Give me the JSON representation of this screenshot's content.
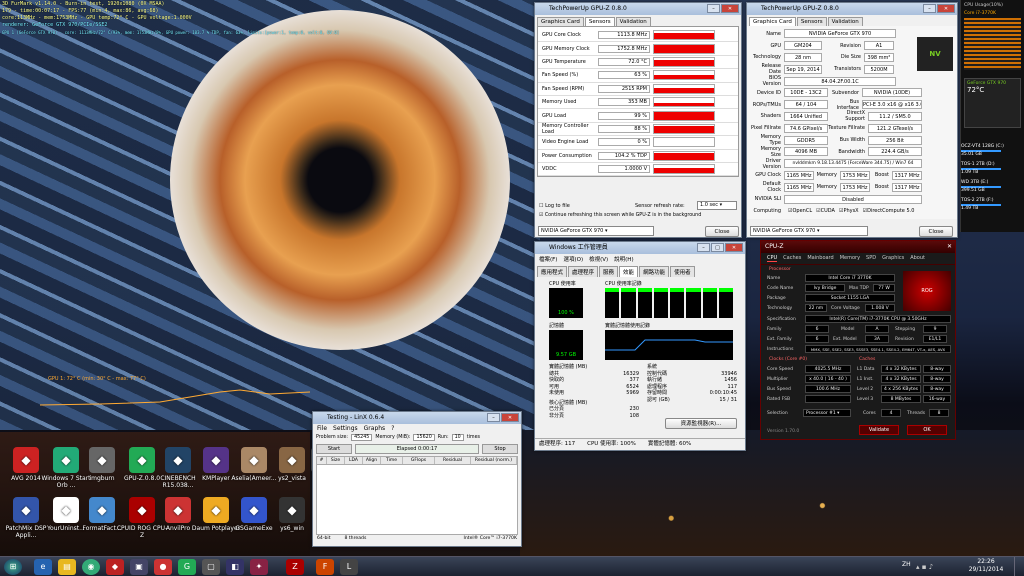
{
  "hud": {
    "lines": [
      "3D FurMark v1.14.0 - Burn-in test, 1920x1080 (0X MSAA)",
      "179 - time:00:07:17 - FPS:77 (min:4, max:86, avg:68)",
      "core:113MHz - mem:1753MHz - GPU temp:72° C - GPU voltage:1.000V",
      "renderer: GeForce GTX 970/PCIe/SSE2",
      "GPU 1 (GeForce GTX 970) - core: 1113MHz/72° C/93%, mem: 1753MHz/8%, GPU power: 103.7 % TDP, fan: 63%, limits:[power:1, temp:0, volt:0, OV:0]"
    ],
    "gpu_graph_label": "GPU 1: 72° C (min: 30° C - max: 77° C)"
  },
  "desktop_icons": [
    {
      "label": "AVG 2014",
      "icon": "avg-icon",
      "color": "#c22"
    },
    {
      "label": "Windows 7 Start Orb ...",
      "icon": "windows-orb-icon",
      "color": "#2a7"
    },
    {
      "label": "imgburn",
      "icon": "imgburn-icon",
      "color": "#666"
    },
    {
      "label": "GPU-Z.0.8.0",
      "icon": "gpuz-icon",
      "color": "#2a5"
    },
    {
      "label": "CINEBENCH R15.038...",
      "icon": "cinebench-icon",
      "color": "#246"
    },
    {
      "label": "KMPlayer",
      "icon": "kmplayer-icon",
      "color": "#538"
    },
    {
      "label": "Aselia(Ameer...",
      "icon": "anime-icon",
      "color": "#a86"
    },
    {
      "label": "ys2_vista",
      "icon": "ys2-icon",
      "color": "#864"
    },
    {
      "label": "GPU...",
      "icon": "gpu-folder-icon",
      "color": "#555"
    },
    {
      "label": "PatchMix DSP Appli...",
      "icon": "patchmix-icon",
      "color": "#35a"
    },
    {
      "label": "YourUninst...",
      "icon": "uninstaller-icon",
      "color": "#fff"
    },
    {
      "label": "FormatFact...",
      "icon": "formatfactory-icon",
      "color": "#48c"
    },
    {
      "label": "CPUID ROG CPU-Z",
      "icon": "cpuz-rog-icon",
      "color": "#a00"
    },
    {
      "label": "AnvilPro",
      "icon": "anvil-icon",
      "color": "#c33"
    },
    {
      "label": "Daum Potplayer",
      "icon": "potplayer-icon",
      "color": "#ea2"
    },
    {
      "label": "GSGameExe",
      "icon": "gsgame-icon",
      "color": "#35c"
    },
    {
      "label": "ys6_win",
      "icon": "ys6-icon",
      "color": "#333"
    }
  ],
  "gpuz_sensors": {
    "title": "TechPowerUp GPU-Z 0.8.0",
    "tabs": [
      "Graphics Card",
      "Sensors",
      "Validation"
    ],
    "rows": [
      {
        "name": "GPU Core Clock",
        "value": "1113.8 MHz",
        "level": 0.8
      },
      {
        "name": "GPU Memory Clock",
        "value": "1752.8 MHz",
        "level": 0.9
      },
      {
        "name": "GPU Temperature",
        "value": "72.0 °C",
        "level": 0.7
      },
      {
        "name": "Fan Speed (%)",
        "value": "63 %",
        "level": 0.6
      },
      {
        "name": "Fan Speed (RPM)",
        "value": "2515 RPM",
        "level": 0.6
      },
      {
        "name": "Memory Used",
        "value": "353 MB",
        "level": 0.4
      },
      {
        "name": "GPU Load",
        "value": "99 %",
        "level": 0.95
      },
      {
        "name": "Memory Controller Load",
        "value": "88 %",
        "level": 0.85
      },
      {
        "name": "Video Engine Load",
        "value": "0 %",
        "level": 0
      },
      {
        "name": "Power Consumption",
        "value": "104.2 % TDP",
        "level": 0.9
      },
      {
        "name": "VDDC",
        "value": "1.0000 V",
        "level": 0.7
      }
    ],
    "log_label": "Log to file",
    "refresh_label": "Sensor refresh rate:",
    "refresh_value": "1.0 sec",
    "continue_label": "Continue refreshing this screen while GPU-Z is in the background",
    "card": "NVIDIA GeForce GTX 970",
    "close": "Close"
  },
  "gpuz_card": {
    "title": "TechPowerUp GPU-Z 0.8.0",
    "tabs": [
      "Graphics Card",
      "Sensors",
      "Validation"
    ],
    "name_label": "Name",
    "name": "NVIDIA GeForce GTX 970",
    "gpu": "GM204",
    "revision": "A1",
    "technology": "28 nm",
    "die_size": "398 mm²",
    "release": "Sep 19, 2014",
    "transistors": "5200M",
    "bios": "84.04.2F.00.1C",
    "device_id": "10DE - 13C2",
    "subvendor": "NVIDIA (10DE)",
    "rops": "64 / 104",
    "bus": "PCI-E 3.0 x16 @ x16 3.0",
    "shaders": "1664 Unified",
    "directx": "11.2 / SM5.0",
    "pixel_fill": "74.6 GPixel/s",
    "texture_fill": "121.2 GTexel/s",
    "mem_type": "GDDR5",
    "bus_width": "256 Bit",
    "mem_size": "4096 MB",
    "bandwidth": "224.4 GB/s",
    "driver": "nvlddmkm 9.18.13.4475 (ForceWare 344.75) / Win7 64",
    "gpu_clock": "1165 MHz",
    "memory_clock": "1753 MHz",
    "boost": "1317 MHz",
    "default_clock": "1165 MHz",
    "default_memory": "1753 MHz",
    "default_boost": "1317 MHz",
    "sli": "Disabled",
    "computing": [
      "OpenCL",
      "CUDA",
      "PhysX",
      "DirectCompute 5.0"
    ],
    "labels": {
      "gpu": "GPU",
      "revision": "Revision",
      "technology": "Technology",
      "die_size": "Die Size",
      "release": "Release Date",
      "transistors": "Transistors",
      "bios": "BIOS Version",
      "device_id": "Device ID",
      "subvendor": "Subvendor",
      "rops": "ROPs/TMUs",
      "bus": "Bus Interface",
      "shaders": "Shaders",
      "directx": "DirectX Support",
      "pixel_fill": "Pixel Fillrate",
      "texture_fill": "Texture Fillrate",
      "mem_type": "Memory Type",
      "bus_width": "Bus Width",
      "mem_size": "Memory Size",
      "bandwidth": "Bandwidth",
      "driver": "Driver Version",
      "gpu_clock": "GPU Clock",
      "memory": "Memory",
      "boost": "Boost",
      "default_clock": "Default Clock",
      "sli": "NVIDIA SLI",
      "computing": "Computing"
    },
    "close": "Close"
  },
  "taskmgr": {
    "title": "Windows 工作管理員",
    "menu": [
      "檔案(F)",
      "選項(O)",
      "檢視(V)",
      "說明(H)"
    ],
    "tabs": [
      "應用程式",
      "處理程序",
      "服務",
      "效能",
      "網路功能",
      "使用者"
    ],
    "cpu_usage_label": "CPU 使用率",
    "cpu_usage": "100 %",
    "cpu_history_label": "CPU 使用率記錄",
    "mem_label": "記憶體",
    "mem_value": "9.57 GB",
    "mem_history_label": "實體記憶體使用記錄",
    "phys_mem_label": "實體記憶體 (MB)",
    "total_l": "總共",
    "total": "16329",
    "cached_l": "快取的",
    "cached": "377",
    "avail_l": "可用",
    "avail": "6524",
    "free_l": "未使用",
    "free": "5969",
    "kernel_label": "核心記憶體 (MB)",
    "paged_l": "已分頁",
    "paged": "230",
    "nonpaged_l": "非分頁",
    "nonpaged": "108",
    "system_label": "系統",
    "handles_l": "控制代碼",
    "handles": "33946",
    "threads_l": "執行緒",
    "threads": "1456",
    "processes_l": "處理程序",
    "processes": "117",
    "uptime_l": "存留時間",
    "uptime": "0:00:10:45",
    "commit_l": "認可 (GB)",
    "commit": "15 / 31",
    "resmon": "資源監視器(R)...",
    "status_processes": "處理程序: 117",
    "status_cpu": "CPU 使用率: 100%",
    "status_mem": "實體記憶體: 60%"
  },
  "linx": {
    "title": "Testing - LinX 0.6.4",
    "menu": [
      "File",
      "Settings",
      "Graphs",
      "?"
    ],
    "problem_size_l": "Problem size:",
    "problem_size": "45245",
    "memory_l": "Memory (MiB):",
    "memory": "15620",
    "run_l": "Run:",
    "run": "10",
    "runs_unit": "times",
    "start": "Start",
    "elapsed": "Elapsed 0:00:17",
    "stop": "Stop",
    "columns": [
      "#",
      "Size",
      "LDA",
      "Align",
      "Time",
      "GFlops",
      "Residual",
      "Residual (norm.)"
    ],
    "status": [
      "64-bit",
      "8 threads",
      "Intel® Core™ i7-3770K"
    ]
  },
  "cpuz": {
    "title": "CPU-Z",
    "tabs": [
      "CPU",
      "Caches",
      "Mainboard",
      "Memory",
      "SPD",
      "Graphics",
      "About"
    ],
    "processor": "Processor",
    "name_l": "Name",
    "name": "Intel Core i7 3770K",
    "code_l": "Code Name",
    "code": "Ivy Bridge",
    "tdp_l": "Max TDP",
    "tdp": "77 W",
    "package_l": "Package",
    "package": "Socket 1155 LGA",
    "tech_l": "Technology",
    "tech": "22 nm",
    "voltage_l": "Core Voltage",
    "voltage": "1.008 V",
    "spec_l": "Specification",
    "spec": "Intel(R) Core(TM) i7-3770K CPU @ 3.50GHz",
    "family_l": "Family",
    "family": "6",
    "model_l": "Model",
    "model": "A",
    "stepping_l": "Stepping",
    "stepping": "9",
    "ext_family_l": "Ext. Family",
    "ext_family": "6",
    "ext_model_l": "Ext. Model",
    "ext_model": "3A",
    "revision_l": "Revision",
    "revision": "E1/L1",
    "instr_l": "Instructions",
    "instr": "MMX, SSE, SSE2, SSE3, SSSE3, SSE4.1, SSE4.2, EM64T, VT-x, AES, AVX",
    "clocks": "Clocks (Core #0)",
    "core_speed_l": "Core Speed",
    "core_speed": "4025.5 MHz",
    "mult_l": "Multiplier",
    "mult": "x 40.0 ( 16 - 40 )",
    "bus_l": "Bus Speed",
    "bus": "100.6 MHz",
    "fsb_l": "Rated FSB",
    "fsb": "",
    "caches": "Caches",
    "l1d_l": "L1 Data",
    "l1d": "4 x 32 KBytes",
    "l1d_w": "8-way",
    "l1i_l": "L1 Inst.",
    "l1i": "4 x 32 KBytes",
    "l1i_w": "8-way",
    "l2_l": "Level 2",
    "l2": "4 x 256 KBytes",
    "l2_w": "8-way",
    "l3_l": "Level 3",
    "l3": "8 MBytes",
    "l3_w": "16-way",
    "sel_l": "Selection",
    "sel": "Processor #1",
    "cores_l": "Cores",
    "cores": "4",
    "threads_l": "Threads",
    "threads": "8",
    "validate": "Validate",
    "ok": "OK",
    "version": "Version 1.70.0"
  },
  "sidebar": {
    "cpu_usage": "CPU Usage(10%)",
    "cpu_model": "Core i7-3770K",
    "gpu_title": "GeForce GTX 970",
    "gpu_temp": "72°C",
    "drives": [
      {
        "name": "OCZ-VT4 128G (C:)",
        "free": "35.01 GB"
      },
      {
        "name": "TOS-1 2TB (D:)",
        "free": "1.09 TB"
      },
      {
        "name": "WD 3TB (E:)",
        "free": "399.51 GB"
      },
      {
        "name": "TOS-2 2TB (F:)",
        "free": "1.49 TB"
      }
    ]
  },
  "taskbar": {
    "time": "22:26",
    "date": "29/11/2014",
    "lang": "ZH"
  },
  "colors": {
    "accent_red": "#e00000",
    "cpu_green": "#00ff00",
    "rog_red": "#8a0000"
  }
}
